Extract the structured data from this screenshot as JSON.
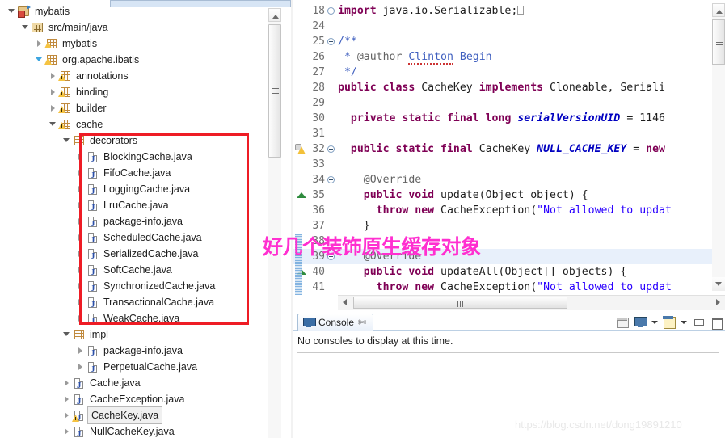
{
  "explorer": {
    "name": "package-explorer",
    "tree": [
      {
        "label": "mybatis",
        "depth": 0,
        "icon": "project-icon",
        "twisty": "expanded",
        "selected": false
      },
      {
        "label": "src/main/java",
        "depth": 1,
        "icon": "source-folder-icon",
        "twisty": "expanded",
        "selected": false
      },
      {
        "label": "mybatis",
        "depth": 2,
        "icon": "package-icon",
        "twisty": "collapsed",
        "selected": false
      },
      {
        "label": "org.apache.ibatis",
        "depth": 2,
        "icon": "package-icon",
        "twisty": "expanded-blue",
        "selected": false
      },
      {
        "label": "annotations",
        "depth": 3,
        "icon": "package-icon",
        "twisty": "collapsed",
        "selected": false
      },
      {
        "label": "binding",
        "depth": 3,
        "icon": "package-icon",
        "twisty": "collapsed",
        "selected": false
      },
      {
        "label": "builder",
        "depth": 3,
        "icon": "package-icon",
        "twisty": "collapsed",
        "selected": false
      },
      {
        "label": "cache",
        "depth": 3,
        "icon": "package-icon",
        "twisty": "expanded",
        "selected": false
      },
      {
        "label": "decorators",
        "depth": 4,
        "icon": "package-icon-plain",
        "twisty": "expanded",
        "selected": false
      },
      {
        "label": "BlockingCache.java",
        "depth": 5,
        "icon": "java-file-icon",
        "twisty": "collapsed",
        "selected": false
      },
      {
        "label": "FifoCache.java",
        "depth": 5,
        "icon": "java-file-icon",
        "twisty": "collapsed",
        "selected": false
      },
      {
        "label": "LoggingCache.java",
        "depth": 5,
        "icon": "java-file-icon",
        "twisty": "collapsed",
        "selected": false
      },
      {
        "label": "LruCache.java",
        "depth": 5,
        "icon": "java-file-icon",
        "twisty": "collapsed",
        "selected": false
      },
      {
        "label": "package-info.java",
        "depth": 5,
        "icon": "java-file-icon",
        "twisty": "collapsed",
        "selected": false
      },
      {
        "label": "ScheduledCache.java",
        "depth": 5,
        "icon": "java-file-icon",
        "twisty": "collapsed",
        "selected": false
      },
      {
        "label": "SerializedCache.java",
        "depth": 5,
        "icon": "java-file-icon",
        "twisty": "collapsed",
        "selected": false
      },
      {
        "label": "SoftCache.java",
        "depth": 5,
        "icon": "java-file-icon",
        "twisty": "collapsed",
        "selected": false
      },
      {
        "label": "SynchronizedCache.java",
        "depth": 5,
        "icon": "java-file-icon",
        "twisty": "collapsed",
        "selected": false
      },
      {
        "label": "TransactionalCache.java",
        "depth": 5,
        "icon": "java-file-icon",
        "twisty": "collapsed",
        "selected": false
      },
      {
        "label": "WeakCache.java",
        "depth": 5,
        "icon": "java-file-icon",
        "twisty": "collapsed",
        "selected": false
      },
      {
        "label": "impl",
        "depth": 4,
        "icon": "package-icon-plain",
        "twisty": "expanded",
        "selected": false
      },
      {
        "label": "package-info.java",
        "depth": 5,
        "icon": "java-file-icon",
        "twisty": "collapsed",
        "selected": false
      },
      {
        "label": "PerpetualCache.java",
        "depth": 5,
        "icon": "java-file-icon",
        "twisty": "collapsed",
        "selected": false
      },
      {
        "label": "Cache.java",
        "depth": 4,
        "icon": "java-file-icon",
        "twisty": "collapsed",
        "selected": false
      },
      {
        "label": "CacheException.java",
        "depth": 4,
        "icon": "java-file-icon",
        "twisty": "collapsed",
        "selected": false
      },
      {
        "label": "CacheKey.java",
        "depth": 4,
        "icon": "java-file-warning-icon",
        "twisty": "collapsed",
        "selected": true
      },
      {
        "label": "NullCacheKey.java",
        "depth": 4,
        "icon": "java-file-icon",
        "twisty": "collapsed",
        "selected": false
      }
    ],
    "annotation_box_color": "#ee1c25"
  },
  "editor": {
    "name": "java-editor",
    "lines": [
      {
        "num": "18",
        "fold": "plus",
        "marker": "",
        "current": false,
        "tokens": [
          {
            "t": "import",
            "c": "kw"
          },
          {
            "t": " java.io.Serializable;",
            "c": "kwn"
          },
          {
            "t": "□",
            "c": "box"
          }
        ]
      },
      {
        "num": "24",
        "fold": "",
        "marker": "",
        "current": false,
        "tokens": []
      },
      {
        "num": "25",
        "fold": "minus",
        "marker": "",
        "current": false,
        "tokens": [
          {
            "t": "/**",
            "c": "cm"
          }
        ]
      },
      {
        "num": "26",
        "fold": "",
        "marker": "",
        "current": false,
        "tokens": [
          {
            "t": " * ",
            "c": "cm"
          },
          {
            "t": "@author",
            "c": "an"
          },
          {
            "t": " ",
            "c": "cm"
          },
          {
            "t": "Clinton",
            "c": "cm-spell"
          },
          {
            "t": " Begin",
            "c": "cm"
          }
        ]
      },
      {
        "num": "27",
        "fold": "",
        "marker": "",
        "current": false,
        "tokens": [
          {
            "t": " */",
            "c": "cm"
          }
        ]
      },
      {
        "num": "28",
        "fold": "",
        "marker": "",
        "current": false,
        "tokens": [
          {
            "t": "public class",
            "c": "kw"
          },
          {
            "t": " CacheKey ",
            "c": "kwn"
          },
          {
            "t": "implements",
            "c": "kw"
          },
          {
            "t": " Cloneable, Seriali",
            "c": "kwn"
          }
        ]
      },
      {
        "num": "29",
        "fold": "",
        "marker": "",
        "current": false,
        "tokens": []
      },
      {
        "num": "30",
        "fold": "",
        "marker": "",
        "current": false,
        "tokens": [
          {
            "t": "  ",
            "c": "kwn"
          },
          {
            "t": "private static final long",
            "c": "kw"
          },
          {
            "t": " ",
            "c": "kwn"
          },
          {
            "t": "serialVersionUID",
            "c": "fld"
          },
          {
            "t": " = 1146",
            "c": "kwn"
          }
        ]
      },
      {
        "num": "31",
        "fold": "",
        "marker": "",
        "current": false,
        "tokens": []
      },
      {
        "num": "32",
        "fold": "minus",
        "marker": "warning",
        "current": false,
        "tokens": [
          {
            "t": "  ",
            "c": "kwn"
          },
          {
            "t": "public static final",
            "c": "kw"
          },
          {
            "t": " CacheKey ",
            "c": "kwn"
          },
          {
            "t": "NULL_CACHE_KEY",
            "c": "fld"
          },
          {
            "t": " = ",
            "c": "kwn"
          },
          {
            "t": "new",
            "c": "kw"
          }
        ]
      },
      {
        "num": "33",
        "fold": "",
        "marker": "",
        "current": false,
        "tokens": []
      },
      {
        "num": "34",
        "fold": "minus",
        "marker": "",
        "current": false,
        "tokens": [
          {
            "t": "    ",
            "c": "kwn"
          },
          {
            "t": "@Override",
            "c": "an"
          }
        ]
      },
      {
        "num": "35",
        "fold": "",
        "marker": "override",
        "current": false,
        "tokens": [
          {
            "t": "    ",
            "c": "kwn"
          },
          {
            "t": "public void",
            "c": "kw"
          },
          {
            "t": " update(Object object) {",
            "c": "kwn"
          }
        ]
      },
      {
        "num": "36",
        "fold": "",
        "marker": "",
        "current": false,
        "tokens": [
          {
            "t": "      ",
            "c": "kwn"
          },
          {
            "t": "throw new",
            "c": "kw"
          },
          {
            "t": " CacheException(",
            "c": "kwn"
          },
          {
            "t": "\"Not allowed to updat",
            "c": "str"
          }
        ]
      },
      {
        "num": "37",
        "fold": "",
        "marker": "",
        "current": false,
        "tokens": [
          {
            "t": "    }",
            "c": "kwn"
          }
        ]
      },
      {
        "num": "38",
        "fold": "",
        "marker": "",
        "current": false,
        "tokens": []
      },
      {
        "num": "39",
        "fold": "minus",
        "marker": "",
        "current": true,
        "tokens": [
          {
            "t": "    ",
            "c": "kwn"
          },
          {
            "t": "@Override",
            "c": "an"
          }
        ]
      },
      {
        "num": "40",
        "fold": "",
        "marker": "override",
        "current": false,
        "tokens": [
          {
            "t": "    ",
            "c": "kwn"
          },
          {
            "t": "public void",
            "c": "kw"
          },
          {
            "t": " updateAll(Object[] objects) {",
            "c": "kwn"
          }
        ]
      },
      {
        "num": "41",
        "fold": "",
        "marker": "",
        "current": false,
        "tokens": [
          {
            "t": "      ",
            "c": "kwn"
          },
          {
            "t": "throw new",
            "c": "kw"
          },
          {
            "t": " CacheException(",
            "c": "kwn"
          },
          {
            "t": "\"Not allowed to updat",
            "c": "str"
          }
        ]
      }
    ]
  },
  "console": {
    "tab_label": "Console",
    "close_glyph": "✄",
    "message": "No consoles to display at this time.",
    "toolbar": [
      "open-console-icon",
      "display-selected-console-icon",
      "display-dropdown-arrow-icon",
      "new-console-view-icon",
      "new-console-dropdown-arrow-icon",
      "minimize-icon",
      "maximize-icon"
    ]
  },
  "annotation": {
    "pink_text": "好几个装饰原生缓存对象",
    "pink_color": "#ff2fd0"
  },
  "watermark": {
    "text": "https://blog.csdn.net/dong19891210"
  }
}
